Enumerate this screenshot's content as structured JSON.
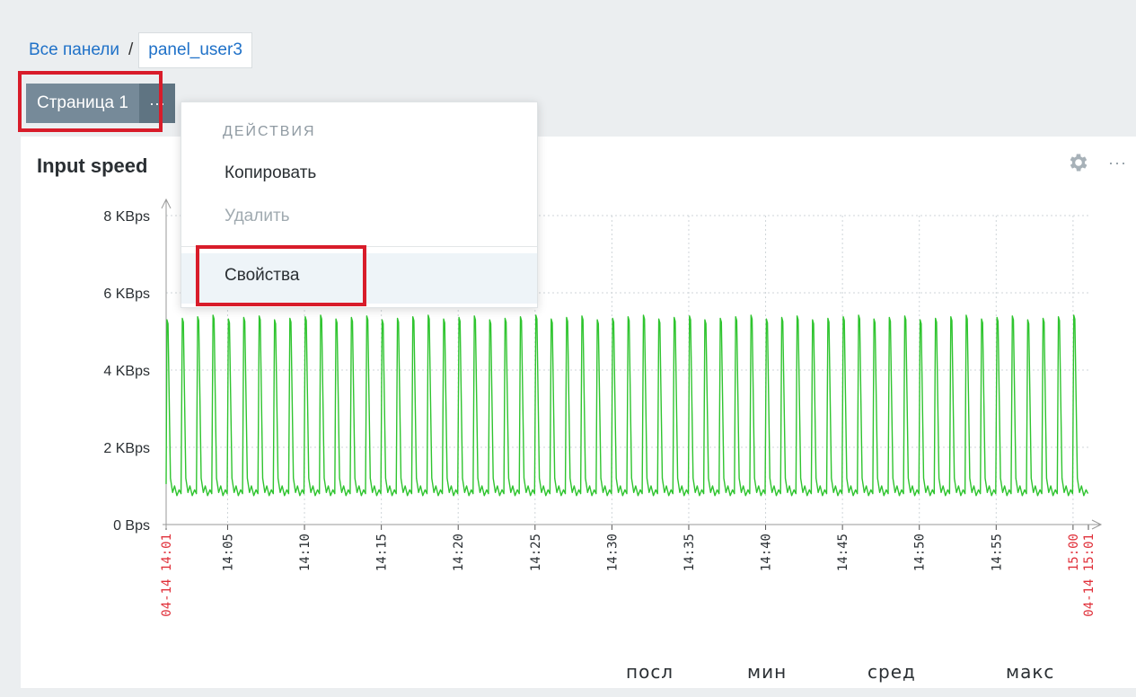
{
  "breadcrumb": {
    "all_panels": "Все панели",
    "separator": "/",
    "current": "panel_user3"
  },
  "page_tab": {
    "label": "Страница 1",
    "more_glyph": "···"
  },
  "widget": {
    "title": "Input speed",
    "more_glyph": "···"
  },
  "menu": {
    "header": "ДЕЙСТВИЯ",
    "copy": "Копировать",
    "delete": "Удалить",
    "properties": "Свойства"
  },
  "legend": {
    "last": "посл",
    "min": "мин",
    "avg": "сред",
    "max": "макс"
  },
  "colors": {
    "series": "#2fc42f",
    "highlight": "#d81c2a",
    "link": "#1f71c8",
    "time_red": "#e0303a"
  },
  "chart_data": {
    "type": "line",
    "y_ticks": [
      "8 KBps",
      "6 KBps",
      "4 KBps",
      "2 KBps",
      "0 Bps"
    ],
    "y_tick_values": [
      8,
      6,
      4,
      2,
      0
    ],
    "ylim": [
      0,
      8
    ],
    "y_unit": "KBps",
    "x_ticks": [
      "04-14 14:01",
      "14:05",
      "14:10",
      "14:15",
      "14:20",
      "14:25",
      "14:30",
      "14:35",
      "14:40",
      "14:45",
      "14:50",
      "14:55",
      "15:00",
      "04-14 15:01"
    ],
    "x_tick_minutes": [
      0,
      4,
      9,
      14,
      19,
      24,
      29,
      34,
      39,
      44,
      49,
      54,
      59,
      60
    ],
    "x_tick_red": [
      true,
      false,
      false,
      false,
      false,
      false,
      false,
      false,
      false,
      false,
      false,
      false,
      true,
      true
    ],
    "xlim_minutes": [
      0,
      60
    ],
    "series": [
      {
        "pattern": "periodic spikes",
        "period_minutes": 1,
        "baseline": 0.75,
        "peak": 5.4
      }
    ],
    "grid": true
  }
}
